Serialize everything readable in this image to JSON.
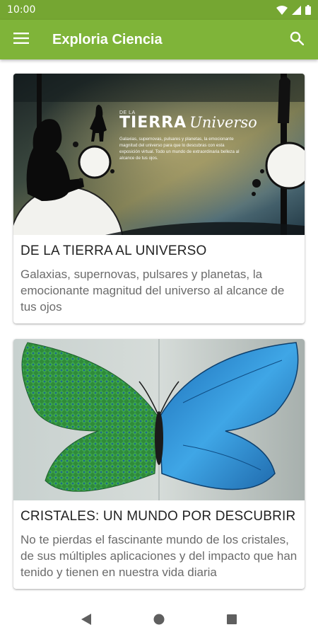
{
  "status_bar": {
    "time": "10:00",
    "icons": [
      "wifi-icon",
      "signal-icon",
      "battery-icon"
    ]
  },
  "app_bar": {
    "title": "Exploria Ciencia",
    "menu_icon": "hamburger-menu-icon",
    "search_icon": "search-icon"
  },
  "cards": [
    {
      "title": "DE LA TIERRA AL UNIVERSO",
      "description": "Galaxias, supernovas, pulsares y planetas, la emocionante magnitud del universo al alcance de tus ojos",
      "image": {
        "small_heading": "DE LA",
        "heading": "TIERRA",
        "heading_script": "Universo",
        "caption": "Galaxias, supernovas, pulsares y planetas, la emocionante magnitud del universo para que lo descubras con esta exposición virtual. Todo un mundo de extraordinaria belleza al alcance de tus ojos."
      }
    },
    {
      "title": "CRISTALES: UN MUNDO POR DESCUBRIR",
      "description": "No te pierdas el fascinante mundo de los cristales, de sus múltiples aplicaciones y del impacto que han tenido y tienen en nuestra vida diaria"
    }
  ],
  "nav_bar": {
    "back_icon": "back-triangle-icon",
    "home_icon": "home-circle-icon",
    "recents_icon": "recents-square-icon"
  },
  "colors": {
    "status_bar": "#75a632",
    "app_bar": "#7fb439",
    "text_primary": "#222222",
    "text_secondary": "#6b6b6b"
  }
}
